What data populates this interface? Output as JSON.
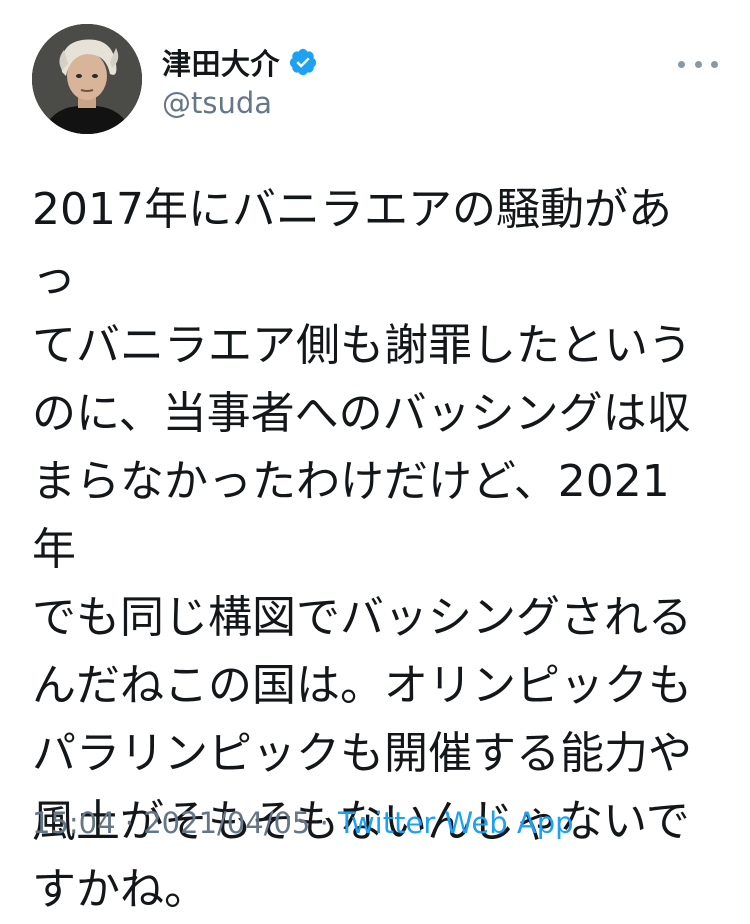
{
  "user": {
    "display_name": "津田大介",
    "handle": "@tsuda",
    "verified": true
  },
  "tweet": {
    "text": "2017年にバニラエアの騒動があっ\nてバニラエア側も謝罪したという\nのに、当事者へのバッシングは収\nまらなかったわけだけど、2021年\nでも同じ構図でバッシングされる\nんだねこの国は。オリンピックも\nパラリンピックも開催する能力や\n風土がそもそもないんじゃないで\nすかね。"
  },
  "meta": {
    "time": "15:04",
    "sep1": " · ",
    "date": "2021/04/05",
    "sep2": " · ",
    "source": "Twitter Web App"
  },
  "icons": {
    "verified": "verified-badge-icon",
    "more": "more-options-icon"
  },
  "colors": {
    "text": "#14171a",
    "secondary": "#657786",
    "accent": "#1da1f2"
  }
}
